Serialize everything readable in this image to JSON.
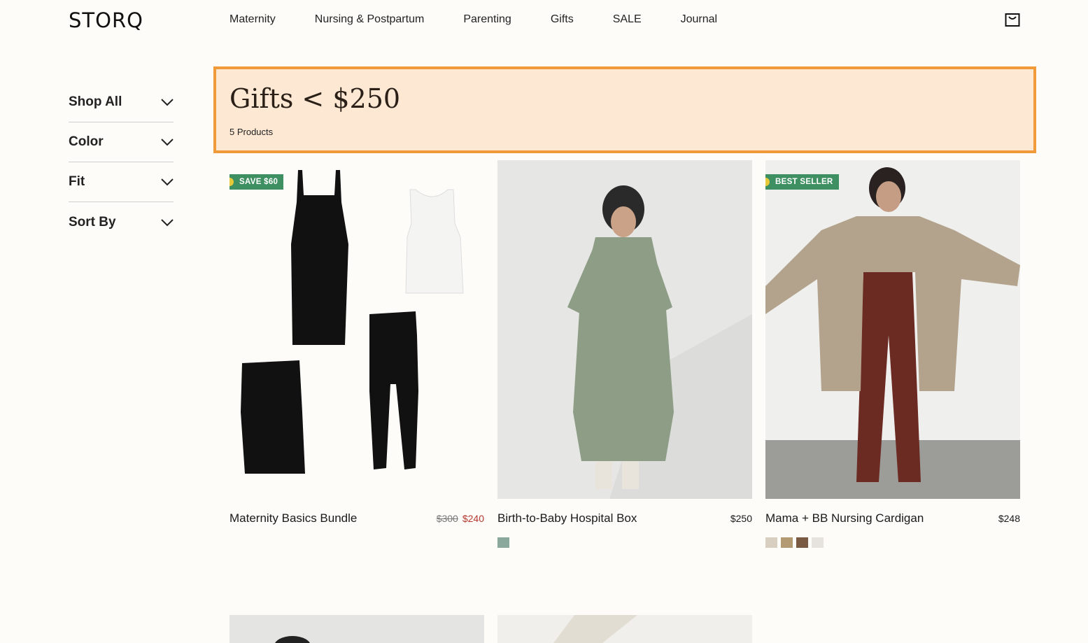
{
  "header": {
    "logo": "STORQ",
    "nav": [
      "Maternity",
      "Nursing & Postpartum",
      "Parenting",
      "Gifts",
      "SALE",
      "Journal"
    ]
  },
  "sidebar": {
    "filters": [
      "Shop All",
      "Color",
      "Fit",
      "Sort By"
    ]
  },
  "collection": {
    "title": "Gifts < $250",
    "count": "5 Products"
  },
  "products": [
    {
      "name": "Maternity Basics Bundle",
      "badge": "SAVE $60",
      "price_original": "$300",
      "price_sale": "$240",
      "swatches": []
    },
    {
      "name": "Birth-to-Baby Hospital Box",
      "price": "$250",
      "swatches": [
        "#8aa89b"
      ]
    },
    {
      "name": "Mama + BB Nursing Cardigan",
      "badge": "BEST SELLER",
      "price": "$248",
      "swatches": [
        "#d9cfc1",
        "#b49a72",
        "#7a5a43",
        "#e6e2de"
      ]
    }
  ],
  "colors": {
    "background": "#fdfcf8",
    "banner_bg": "#fde8d3",
    "banner_border": "#f09a3a",
    "badge": "#3e8f62",
    "sale_price": "#b5392f"
  }
}
